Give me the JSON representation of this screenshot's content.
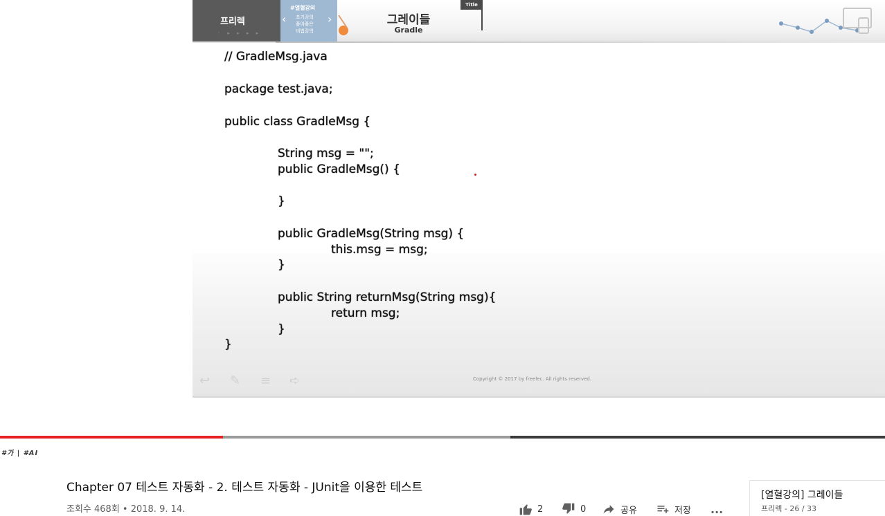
{
  "slide": {
    "brand": "프리렉",
    "nav_label": "#열혈강의",
    "nav_sub_lines": [
      "초기강의",
      "좋아좋은",
      "비법강의"
    ],
    "title_ko": "그레이들",
    "title_en": "Gradle",
    "title_tab": "Title",
    "code_lines": [
      "// GradleMsg.java",
      "package test.java;",
      "public class GradleMsg {",
      "String msg = \"\";",
      "public GradleMsg() {",
      "}",
      "public GradleMsg(String msg) {",
      "this.msg = msg;",
      "}",
      "public String returnMsg(String msg){",
      "return msg;",
      "}",
      "}"
    ],
    "copyright": "Copyright © 2017 by freelec. All rights reserved."
  },
  "player": {
    "played_fraction": 0.252,
    "buffered_fraction": 0.577
  },
  "tag_line": "#가 | #AI",
  "video": {
    "title": "Chapter 07 테스트 자동화 - 2. 테스트 자동화 - JUnit을 이용한 테스트",
    "meta": "조회수 468회 • 2018. 9. 14.",
    "like_count": "2",
    "dislike_count": "0",
    "share_label": "공유",
    "save_label": "저장",
    "more_label": "..."
  },
  "playlist": {
    "title": "[열혈강의] 그레이들",
    "subtitle": "프리렉 - 26 / 33"
  },
  "icons": {
    "like": "thumbs-up-icon",
    "dislike": "thumbs-down-icon",
    "share": "share-arrow-icon",
    "save": "add-to-playlist-icon",
    "more": "more-horizontal-icon"
  },
  "colors": {
    "progress_played": "#e52222",
    "progress_buffered": "#9b9b9b",
    "progress_track": "#3b3b3b",
    "header_brand": "#5a5a5a",
    "header_nav": "#9fb9d2"
  }
}
